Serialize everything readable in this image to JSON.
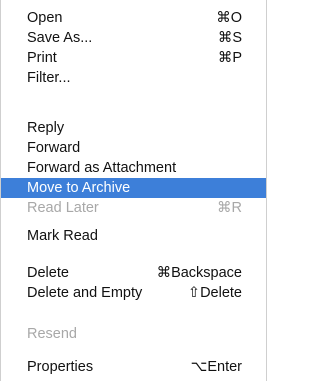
{
  "menu": {
    "selection_color": "#3d7fd9",
    "disabled_color": "#a8a8a8",
    "items": [
      {
        "label": "Open",
        "shortcut": "⌘O"
      },
      {
        "label": "Save As...",
        "shortcut": "⌘S"
      },
      {
        "label": "Print",
        "shortcut": "⌘P"
      },
      {
        "label": "Filter...",
        "shortcut": ""
      },
      {
        "label": "Reply",
        "shortcut": ""
      },
      {
        "label": "Forward",
        "shortcut": ""
      },
      {
        "label": "Forward as Attachment",
        "shortcut": ""
      },
      {
        "label": "Move to Archive",
        "shortcut": "",
        "selected": true
      },
      {
        "label": "Read Later",
        "shortcut": "⌘R",
        "disabled": true
      },
      {
        "label": "Mark Read",
        "shortcut": ""
      },
      {
        "label": "Delete",
        "shortcut": "⌘Backspace"
      },
      {
        "label": "Delete and Empty",
        "shortcut": "⇧Delete"
      },
      {
        "label": "Resend",
        "shortcut": "",
        "disabled": true
      },
      {
        "label": "Properties",
        "shortcut": "⌥Enter"
      }
    ]
  }
}
